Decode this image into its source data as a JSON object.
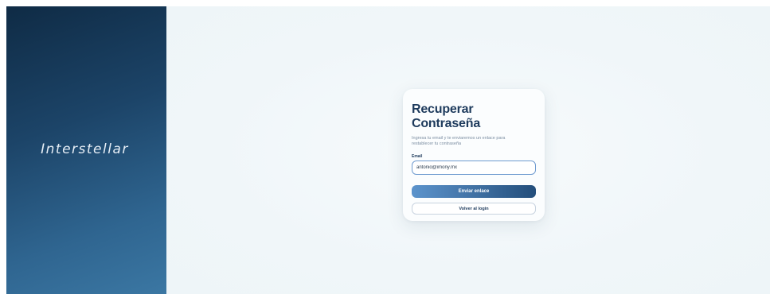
{
  "brand": {
    "name": "Interstellar"
  },
  "recovery_form": {
    "title": "Recuperar Contraseña",
    "subtitle": "Ingresa tu email y te enviaremos un enlace para restablecer tu contraseña",
    "email_label": "Email",
    "email_value": "antonio@imony.mx",
    "submit_label": "Enviar enlace",
    "back_label": "Volver al login"
  },
  "colors": {
    "sidebar_dark": "#0f2b45",
    "sidebar_light": "#3b77a3",
    "title": "#1d3a5c",
    "primary_start": "#5b93cc",
    "primary_end": "#234e7b",
    "background": "#f2f8fa"
  }
}
